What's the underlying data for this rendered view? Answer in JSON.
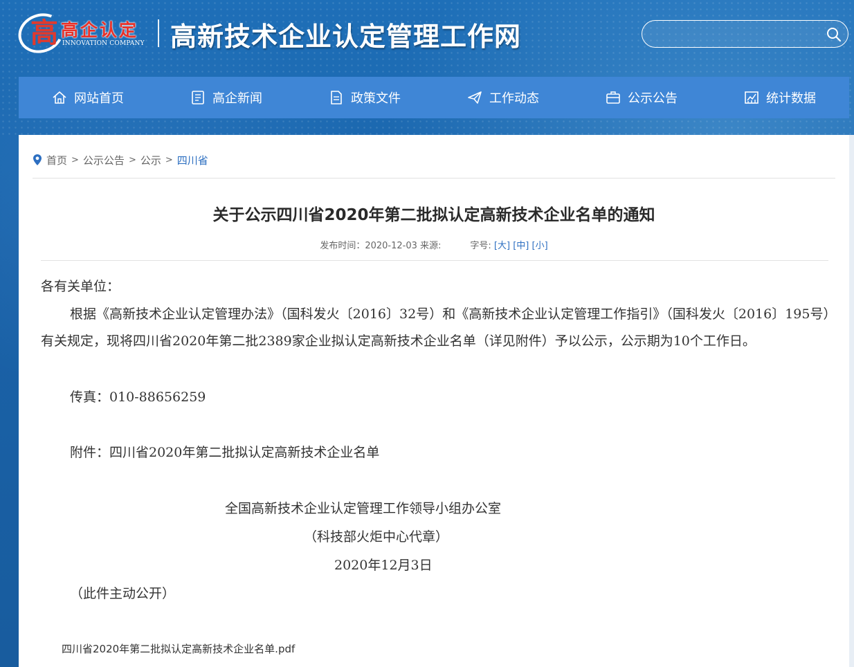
{
  "header": {
    "logo_cn": "高企认定",
    "logo_en": "INNOVATION COMPANY",
    "site_title": "高新技术企业认定管理工作网",
    "search_placeholder": ""
  },
  "nav": {
    "items": [
      {
        "label": "网站首页",
        "icon": "home-icon"
      },
      {
        "label": "高企新闻",
        "icon": "news-icon"
      },
      {
        "label": "政策文件",
        "icon": "document-icon"
      },
      {
        "label": "工作动态",
        "icon": "paper-plane-icon"
      },
      {
        "label": "公示公告",
        "icon": "briefcase-icon"
      },
      {
        "label": "统计数据",
        "icon": "chart-icon"
      }
    ]
  },
  "breadcrumb": {
    "items": [
      "首页",
      "公示公告",
      "公示",
      "四川省"
    ],
    "separator": ">"
  },
  "article": {
    "title": "关于公示四川省2020年第二批拟认定高新技术企业名单的通知",
    "meta_date": "发布时间：2020-12-03 来源:",
    "meta_font_label": "字号:",
    "font_large": "[大]",
    "font_medium": "[中]",
    "font_small": "[小]",
    "salutation": "各有关单位：",
    "paragraph": "根据《高新技术企业认定管理办法》（国科发火〔2016〕32号）和《高新技术企业认定管理工作指引》（国科发火〔2016〕195号）有关规定，现将四川省2020年第二批2389家企业拟认定高新技术企业名单（详见附件）予以公示，公示期为10个工作日。",
    "fax": "传真：010-88656259",
    "attachment_note": "附件：四川省2020年第二批拟认定高新技术企业名单",
    "signature_org": "全国高新技术企业认定管理工作领导小组办公室",
    "signature_seal": "（科技部火炬中心代章）",
    "signature_date": "2020年12月3日",
    "disclosure": "（此件主动公开）",
    "attachment_file": "四川省2020年第二批拟认定高新技术企业名单.pdf"
  },
  "colors": {
    "nav_bg": "#3f86d6",
    "link_blue": "#2d6fc1",
    "logo_red": "#e8322a"
  }
}
